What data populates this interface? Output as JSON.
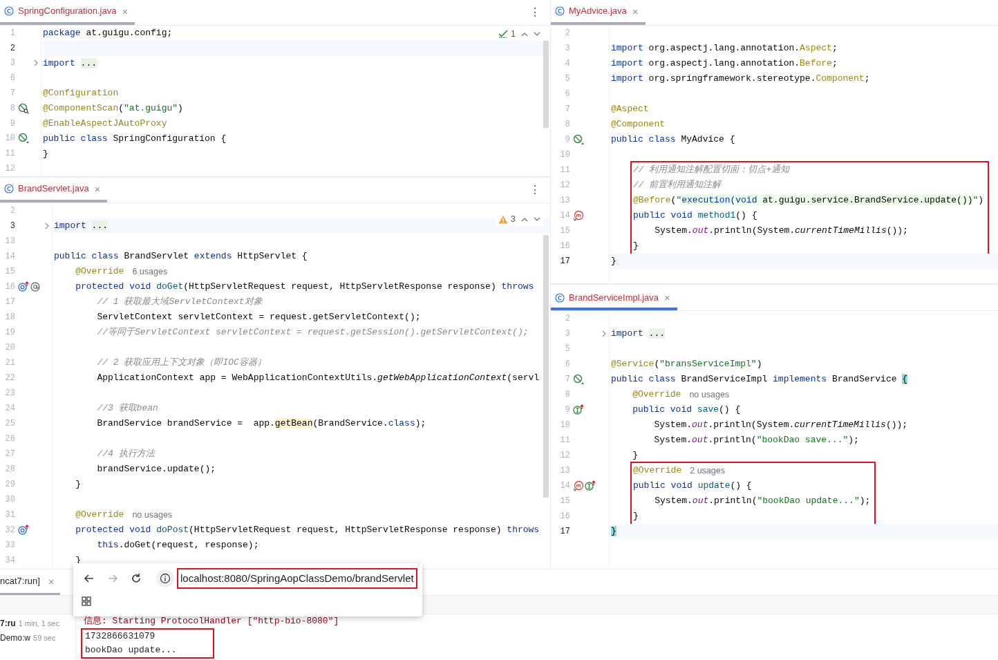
{
  "left_column": [
    {
      "tab": {
        "title": "SpringConfiguration.java",
        "close": "×",
        "active": false
      },
      "menu": "⋮",
      "inspection": {
        "kind": "ok",
        "count": "1"
      },
      "lines": [
        {
          "kind": "line",
          "n": "1",
          "t": [
            {
              "kind": "kw",
              "text": "package"
            },
            {
              "kind": "p",
              "text": " at.guigu.config;"
            }
          ],
          "current": false
        },
        {
          "kind": "line",
          "n": "2",
          "current": true
        },
        {
          "kind": "line",
          "n": "3",
          "t": [
            {
              "kind": "kw",
              "text": "import "
            },
            {
              "kind": "fold",
              "text": "..."
            }
          ],
          "gutter": [
            {
              "kind": "fold"
            }
          ],
          "current": false
        },
        {
          "kind": "line",
          "n": "6",
          "current": false
        },
        {
          "kind": "line",
          "n": "7",
          "t": [
            {
              "kind": "ann",
              "text": "@Configuration"
            }
          ],
          "current": false
        },
        {
          "kind": "line",
          "n": "8",
          "t": [
            {
              "kind": "ann",
              "text": "@ComponentScan"
            },
            {
              "kind": "p",
              "text": "("
            },
            {
              "kind": "str",
              "text": "\"at.guigu\""
            },
            {
              "kind": "p",
              "text": ")"
            }
          ],
          "gutter": [
            {
              "kind": "bean-search"
            }
          ],
          "current": false
        },
        {
          "kind": "line",
          "n": "9",
          "t": [
            {
              "kind": "ann",
              "text": "@EnableAspectJAutoProxy"
            }
          ],
          "current": false
        },
        {
          "kind": "line",
          "n": "10",
          "t": [
            {
              "kind": "kw",
              "text": "public class"
            },
            {
              "kind": "p",
              "text": " SpringConfiguration {"
            }
          ],
          "gutter": [
            {
              "kind": "bean"
            }
          ],
          "current": false
        },
        {
          "kind": "line",
          "n": "11",
          "t": [
            {
              "kind": "p",
              "text": "}"
            }
          ],
          "current": false
        },
        {
          "kind": "line",
          "n": "12",
          "current": false
        }
      ]
    },
    {
      "tab": {
        "title": "BrandServlet.java",
        "close": "×",
        "active": false
      },
      "menu": "⋮",
      "inspection": {
        "kind": "warning",
        "count": "3"
      },
      "lines": [
        {
          "kind": "line",
          "n": "2",
          "current": false
        },
        {
          "kind": "line",
          "n": "3",
          "t": [
            {
              "kind": "kw",
              "text": "import "
            },
            {
              "kind": "fold",
              "text": "..."
            }
          ],
          "gutter": [
            {
              "kind": "fold"
            }
          ],
          "current": true
        },
        {
          "kind": "line",
          "n": "13",
          "current": false
        },
        {
          "kind": "line",
          "n": "14",
          "t": [
            {
              "kind": "kw",
              "text": "public class"
            },
            {
              "kind": "p",
              "text": " BrandServlet "
            },
            {
              "kind": "kw",
              "text": "extends"
            },
            {
              "kind": "p",
              "text": " HttpServlet {"
            }
          ],
          "current": false
        },
        {
          "kind": "line",
          "n": "15",
          "t": [
            {
              "kind": "ann",
              "text": "    @Override"
            }
          ],
          "hint": "6 usages",
          "current": false
        },
        {
          "kind": "line",
          "n": "16",
          "t": [
            {
              "kind": "kw",
              "text": "    protected void"
            },
            {
              "kind": "m",
              "text": " doGet"
            },
            {
              "kind": "p",
              "text": "(HttpServletRequest request, HttpServletResponse response) "
            },
            {
              "kind": "kw",
              "text": "throws"
            }
          ],
          "gutter": [
            {
              "kind": "override-up"
            },
            {
              "kind": "at"
            }
          ],
          "current": false
        },
        {
          "kind": "line",
          "n": "17",
          "t": [
            {
              "kind": "c",
              "text": "        // 1 获取最大域ServletContext对象"
            }
          ],
          "current": false
        },
        {
          "kind": "line",
          "n": "18",
          "t": [
            {
              "kind": "p",
              "text": "        ServletContext servletContext = request.getServletContext();"
            }
          ],
          "current": false
        },
        {
          "kind": "line",
          "n": "19",
          "t": [
            {
              "kind": "c",
              "text": "        //等同于ServletContext servletContext = request.getSession().getServletContext();"
            }
          ],
          "current": false
        },
        {
          "kind": "line",
          "n": "20",
          "current": false
        },
        {
          "kind": "line",
          "n": "21",
          "t": [
            {
              "kind": "c",
              "text": "        // 2 获取应用上下文对象（即IOC容器）"
            }
          ],
          "current": false
        },
        {
          "kind": "line",
          "n": "22",
          "t": [
            {
              "kind": "p",
              "text": "        ApplicationContext app = WebApplicationContextUtils."
            },
            {
              "kind": "si",
              "text": "getWebApplicationContext"
            },
            {
              "kind": "p",
              "text": "(servl"
            }
          ],
          "current": false
        },
        {
          "kind": "line",
          "n": "23",
          "current": false
        },
        {
          "kind": "line",
          "n": "24",
          "t": [
            {
              "kind": "c",
              "text": "        //3 获取bean"
            }
          ],
          "current": false
        },
        {
          "kind": "line",
          "n": "25",
          "t": [
            {
              "kind": "p",
              "text": "        BrandService brandService =  app."
            },
            {
              "kind": "hl",
              "text": "getBean"
            },
            {
              "kind": "p",
              "text": "(BrandService."
            },
            {
              "kind": "kw",
              "text": "class"
            },
            {
              "kind": "p",
              "text": ");"
            }
          ],
          "current": false
        },
        {
          "kind": "line",
          "n": "26",
          "current": false
        },
        {
          "kind": "line",
          "n": "27",
          "t": [
            {
              "kind": "c",
              "text": "        //4 执行方法"
            }
          ],
          "current": false
        },
        {
          "kind": "line",
          "n": "28",
          "t": [
            {
              "kind": "p",
              "text": "        brandService.update();"
            }
          ],
          "current": false
        },
        {
          "kind": "line",
          "n": "29",
          "t": [
            {
              "kind": "p",
              "text": "    }"
            }
          ],
          "current": false
        },
        {
          "kind": "line",
          "n": "30",
          "current": false
        },
        {
          "kind": "line",
          "n": "31",
          "t": [
            {
              "kind": "ann",
              "text": "    @Override"
            }
          ],
          "hint": "no usages",
          "current": false
        },
        {
          "kind": "line",
          "n": "32",
          "t": [
            {
              "kind": "kw",
              "text": "    protected void"
            },
            {
              "kind": "m",
              "text": " doPost"
            },
            {
              "kind": "p",
              "text": "(HttpServletRequest request, HttpServletResponse response) "
            },
            {
              "kind": "kw",
              "text": "throws"
            }
          ],
          "gutter": [
            {
              "kind": "override-up"
            }
          ],
          "current": false
        },
        {
          "kind": "line",
          "n": "33",
          "t": [
            {
              "kind": "kw",
              "text": "        this"
            },
            {
              "kind": "p",
              "text": ".doGet(request, response);"
            }
          ],
          "current": false
        },
        {
          "kind": "line",
          "n": "34",
          "t": [
            {
              "kind": "p",
              "text": "    }"
            }
          ],
          "current": false
        }
      ]
    }
  ],
  "right_column": [
    {
      "tab": {
        "title": "MyAdvice.java",
        "close": "×",
        "active": false
      },
      "lines": [
        {
          "kind": "line",
          "n": "2",
          "current": false
        },
        {
          "kind": "line",
          "n": "3",
          "t": [
            {
              "kind": "kw",
              "text": "import"
            },
            {
              "kind": "p",
              "text": " org.aspectj.lang.annotation."
            },
            {
              "kind": "ann",
              "text": "Aspect"
            },
            {
              "kind": "p",
              "text": ";"
            }
          ],
          "current": false
        },
        {
          "kind": "line",
          "n": "4",
          "t": [
            {
              "kind": "kw",
              "text": "import"
            },
            {
              "kind": "p",
              "text": " org.aspectj.lang.annotation."
            },
            {
              "kind": "ann",
              "text": "Before"
            },
            {
              "kind": "p",
              "text": ";"
            }
          ],
          "current": false
        },
        {
          "kind": "line",
          "n": "5",
          "t": [
            {
              "kind": "kw",
              "text": "import"
            },
            {
              "kind": "p",
              "text": " org.springframework.stereotype."
            },
            {
              "kind": "ann",
              "text": "Component"
            },
            {
              "kind": "p",
              "text": ";"
            }
          ],
          "current": false
        },
        {
          "kind": "line",
          "n": "6",
          "current": false
        },
        {
          "kind": "line",
          "n": "7",
          "t": [
            {
              "kind": "ann",
              "text": "@Aspect"
            }
          ],
          "current": false
        },
        {
          "kind": "line",
          "n": "8",
          "t": [
            {
              "kind": "ann",
              "text": "@Component"
            }
          ],
          "current": false
        },
        {
          "kind": "line",
          "n": "9",
          "t": [
            {
              "kind": "kw",
              "text": "public class"
            },
            {
              "kind": "p",
              "text": " MyAdvice {"
            }
          ],
          "gutter": [
            {
              "kind": "bean"
            }
          ],
          "current": false
        },
        {
          "kind": "line",
          "n": "10",
          "current": false
        },
        {
          "kind": "frame",
          "lines": [
            {
              "kind": "line",
              "n": "11",
              "t": [
                {
                  "kind": "c",
                  "text": "// 利用通知注解配置切面：切点+通知"
                }
              ],
              "current": false
            },
            {
              "kind": "line",
              "n": "12",
              "t": [
                {
                  "kind": "c",
                  "text": "// 前置利用通知注解"
                }
              ],
              "current": false
            },
            {
              "kind": "line",
              "n": "13",
              "t": [
                {
                  "kind": "ann",
                  "text": "@Before"
                },
                {
                  "kind": "p",
                  "text": "("
                },
                {
                  "kind": "str",
                  "text": "\""
                },
                {
                  "kind": "injkw",
                  "text": "execution(void"
                },
                {
                  "kind": "inj",
                  "text": " at.guigu.service.BrandService.update())"
                },
                {
                  "kind": "str",
                  "text": "\""
                },
                {
                  "kind": "p",
                  "text": ")"
                }
              ],
              "current": false
            },
            {
              "kind": "line",
              "n": "14",
              "t": [
                {
                  "kind": "kw",
                  "text": "public void"
                },
                {
                  "kind": "m",
                  "text": " method1"
                },
                {
                  "kind": "p",
                  "text": "() {"
                }
              ],
              "gutter": [
                {
                  "kind": "advice"
                }
              ],
              "current": false
            },
            {
              "kind": "line",
              "n": "15",
              "t": [
                {
                  "kind": "p",
                  "text": "    System."
                },
                {
                  "kind": "f",
                  "text": "out"
                },
                {
                  "kind": "p",
                  "text": ".println(System."
                },
                {
                  "kind": "si",
                  "text": "currentTimeMillis"
                },
                {
                  "kind": "p",
                  "text": "());"
                }
              ],
              "current": false
            },
            {
              "kind": "line",
              "n": "16",
              "t": [
                {
                  "kind": "p",
                  "text": "}"
                }
              ],
              "current": false
            }
          ]
        },
        {
          "kind": "line",
          "n": "17",
          "t": [
            {
              "kind": "p",
              "text": "}"
            }
          ],
          "current": true
        }
      ]
    },
    {
      "tab": {
        "title": "BrandServiceImpl.java",
        "close": "×",
        "active": true
      },
      "lines": [
        {
          "kind": "line",
          "n": "2",
          "current": false
        },
        {
          "kind": "line",
          "n": "3",
          "t": [
            {
              "kind": "kw",
              "text": "import "
            },
            {
              "kind": "fold",
              "text": "..."
            }
          ],
          "gutter": [
            {
              "kind": "fold"
            }
          ],
          "current": false
        },
        {
          "kind": "line",
          "n": "5",
          "current": false
        },
        {
          "kind": "line",
          "n": "6",
          "t": [
            {
              "kind": "ann",
              "text": "@Service"
            },
            {
              "kind": "p",
              "text": "("
            },
            {
              "kind": "str",
              "text": "\"bransServiceImpl\""
            },
            {
              "kind": "p",
              "text": ")"
            }
          ],
          "current": false
        },
        {
          "kind": "line",
          "n": "7",
          "t": [
            {
              "kind": "kw",
              "text": "public class"
            },
            {
              "kind": "p",
              "text": " BrandServiceImpl "
            },
            {
              "kind": "kw",
              "text": "implements"
            },
            {
              "kind": "p",
              "text": " BrandService "
            },
            {
              "kind": "bh",
              "text": "{"
            }
          ],
          "gutter": [
            {
              "kind": "bean"
            }
          ],
          "current": false
        },
        {
          "kind": "line",
          "n": "8",
          "t": [
            {
              "kind": "ann",
              "text": "    @Override"
            }
          ],
          "hint": "no usages",
          "current": false
        },
        {
          "kind": "line",
          "n": "9",
          "t": [
            {
              "kind": "kw",
              "text": "    public void"
            },
            {
              "kind": "m",
              "text": " save"
            },
            {
              "kind": "p",
              "text": "() {"
            }
          ],
          "gutter": [
            {
              "kind": "impl-up"
            }
          ],
          "current": false
        },
        {
          "kind": "line",
          "n": "10",
          "t": [
            {
              "kind": "p",
              "text": "        System."
            },
            {
              "kind": "f",
              "text": "out"
            },
            {
              "kind": "p",
              "text": ".println(System."
            },
            {
              "kind": "si",
              "text": "currentTimeMillis"
            },
            {
              "kind": "p",
              "text": "());"
            }
          ],
          "current": false
        },
        {
          "kind": "line",
          "n": "11",
          "t": [
            {
              "kind": "p",
              "text": "        System."
            },
            {
              "kind": "f",
              "text": "out"
            },
            {
              "kind": "p",
              "text": ".println("
            },
            {
              "kind": "str",
              "text": "\"bookDao save...\""
            },
            {
              "kind": "p",
              "text": ");"
            }
          ],
          "current": false
        },
        {
          "kind": "line",
          "n": "12",
          "t": [
            {
              "kind": "p",
              "text": "    }"
            }
          ],
          "current": false
        },
        {
          "kind": "frame",
          "lines": [
            {
              "kind": "line",
              "n": "13",
              "t": [
                {
                  "kind": "ann",
                  "text": "@Override"
                }
              ],
              "hint": "2 usages",
              "current": false
            },
            {
              "kind": "line",
              "n": "14",
              "t": [
                {
                  "kind": "kw",
                  "text": "public void"
                },
                {
                  "kind": "m",
                  "text": " update"
                },
                {
                  "kind": "p",
                  "text": "() {"
                }
              ],
              "gutter": [
                {
                  "kind": "advice"
                },
                {
                  "kind": "impl-up"
                }
              ],
              "current": false
            },
            {
              "kind": "line",
              "n": "15",
              "t": [
                {
                  "kind": "p",
                  "text": "    System."
                },
                {
                  "kind": "f",
                  "text": "out"
                },
                {
                  "kind": "p",
                  "text": ".println("
                },
                {
                  "kind": "str",
                  "text": "\"bookDao update...\""
                },
                {
                  "kind": "p",
                  "text": ");"
                }
              ],
              "current": false
            },
            {
              "kind": "line",
              "n": "16",
              "t": [
                {
                  "kind": "p",
                  "text": "}"
                }
              ],
              "current": false
            }
          ]
        },
        {
          "kind": "line",
          "n": "17",
          "t": [
            {
              "kind": "bh",
              "text": "}"
            }
          ],
          "current": true
        }
      ]
    }
  ],
  "run_panel": {
    "tab": {
      "label": "ncat7:run]",
      "close": "×"
    },
    "services": [
      {
        "name": "7:ru",
        "time": "1 min, 1 sec",
        "selected": true
      },
      {
        "name": "Demo:w",
        "time": "59 sec",
        "selected": false
      }
    ],
    "console": [
      {
        "kind": "info",
        "text": "信息: Starting ProtocolHandler [\"http-bio-8080\"]"
      },
      {
        "kind": "frame",
        "lines": [
          {
            "kind": "plain",
            "text": "1732866631079"
          },
          {
            "kind": "plain",
            "text": "bookDao update..."
          }
        ]
      }
    ]
  },
  "browser_popup": {
    "nav": [
      {
        "kind": "back",
        "disabled": false
      },
      {
        "kind": "forward",
        "disabled": true
      },
      {
        "kind": "reload",
        "disabled": false
      }
    ],
    "url": "localhost:8080/SpringAopClassDemo/brandServlet",
    "boxed": true
  }
}
